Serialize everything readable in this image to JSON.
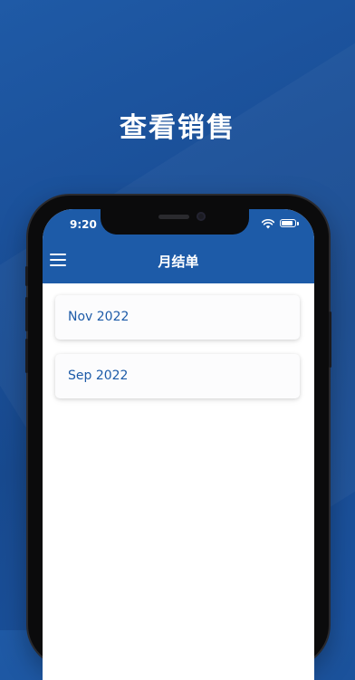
{
  "headline": "查看销售",
  "status_bar": {
    "time": "9:20"
  },
  "navbar": {
    "title": "月结单"
  },
  "statements": [
    {
      "label": "Nov 2022"
    },
    {
      "label": "Sep 2022"
    }
  ],
  "colors": {
    "brand_blue": "#1d5ba8",
    "background_blue": "#1a4f98"
  },
  "icons": {
    "menu": "hamburger-menu-icon",
    "wifi": "wifi-icon",
    "battery": "battery-icon"
  }
}
